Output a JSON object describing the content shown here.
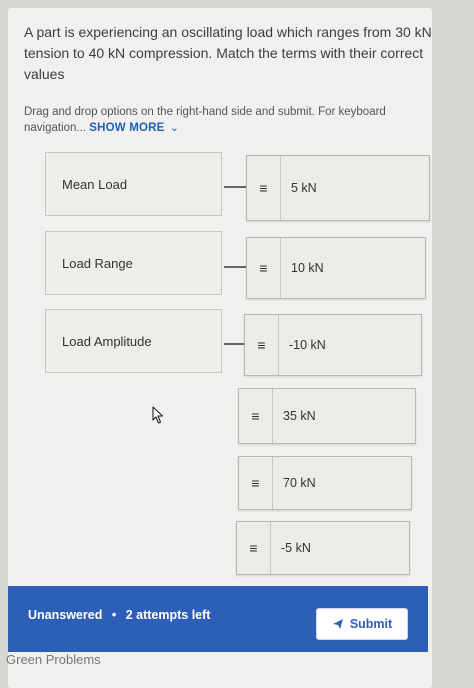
{
  "question": {
    "text": "A part is experiencing an oscillating load which ranges from 30 kN tension to 40 kN compression. Match the terms with their correct values"
  },
  "instructions": {
    "text": "Drag and drop options on the right-hand side and submit. For keyboard navigation...",
    "show_more": "SHOW MORE"
  },
  "terms": [
    {
      "label": "Mean Load"
    },
    {
      "label": "Load Range"
    },
    {
      "label": "Load Amplitude"
    }
  ],
  "options": [
    {
      "value": "5 kN",
      "placed": true
    },
    {
      "value": "10 kN",
      "placed": true
    },
    {
      "value": "-10 kN",
      "placed": true
    },
    {
      "value": "35 kN",
      "placed": false
    },
    {
      "value": "70 kN",
      "placed": false
    },
    {
      "value": "-5 kN",
      "placed": false
    }
  ],
  "footer": {
    "status": "Unanswered",
    "attempts": "2 attempts left",
    "submit_label": "Submit"
  },
  "bottom": {
    "text": "Green Problems"
  },
  "colors": {
    "accent": "#2d5fb9",
    "link": "#1f5fb5"
  },
  "icons": {
    "drag_handle": "drag-handle-icon",
    "submit": "paper-plane-icon",
    "cursor": "pointer-cursor-icon"
  }
}
